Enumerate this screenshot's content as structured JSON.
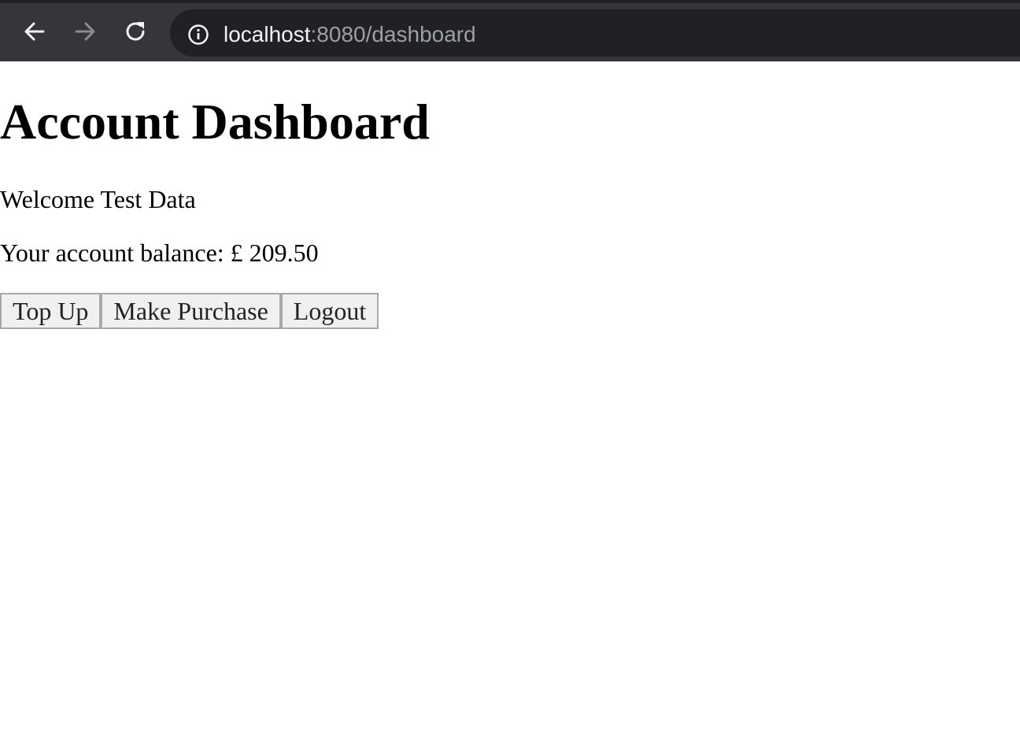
{
  "browser": {
    "url_host": "localhost",
    "url_path": ":8080/dashboard",
    "icons": {
      "back": "back-arrow-icon",
      "forward": "forward-arrow-icon",
      "reload": "reload-icon",
      "info": "info-icon"
    },
    "colors": {
      "toolbar": "#35363a",
      "omnibox": "#202124",
      "host_text": "#f1f3f4",
      "path_text": "#9aa0a6"
    }
  },
  "page": {
    "title": "Account Dashboard",
    "welcome": "Welcome Test Data",
    "balance": "Your account balance: £ 209.50",
    "buttons": {
      "top_up": "Top Up",
      "make_purchase": "Make Purchase",
      "logout": "Logout"
    }
  }
}
